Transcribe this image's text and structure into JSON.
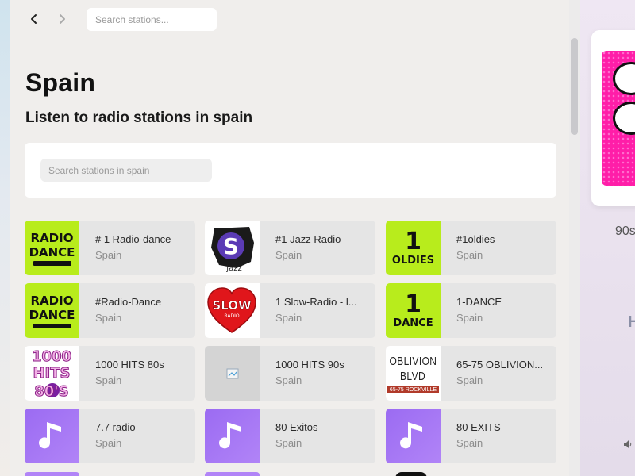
{
  "nav": {
    "back_icon": "chevron-left-icon",
    "forward_icon": "chevron-right-icon",
    "search_placeholder": "Search stations..."
  },
  "page": {
    "title": "Spain",
    "subtitle": "Listen to radio stations in spain",
    "search_placeholder": "Search stations in spain"
  },
  "stations": [
    {
      "name": "# 1 Radio-dance",
      "country": "Spain",
      "thumb": "radio-dance-logo",
      "logo_lines": [
        "RADIO",
        "DANCE"
      ]
    },
    {
      "name": "#1 Jazz Radio",
      "country": "Spain",
      "thumb": "jazz-logo",
      "logo_lines": [
        "jazz"
      ]
    },
    {
      "name": "#1oldies",
      "country": "Spain",
      "thumb": "oldies-logo",
      "logo_lines": [
        "1",
        "OLDIES"
      ]
    },
    {
      "name": "#Radio-Dance",
      "country": "Spain",
      "thumb": "radio-dance-logo",
      "logo_lines": [
        "RADIO",
        "DANCE"
      ]
    },
    {
      "name": "1 Slow-Radio - l...",
      "country": "Spain",
      "thumb": "slow-radio-logo",
      "logo_lines": [
        "SLOW",
        "RADIO"
      ]
    },
    {
      "name": "1-DANCE",
      "country": "Spain",
      "thumb": "dance-logo",
      "logo_lines": [
        "1",
        "DANCE"
      ]
    },
    {
      "name": "1000 HITS 80s",
      "country": "Spain",
      "thumb": "hits-80s-logo",
      "logo_lines": [
        "1000",
        "HITS",
        "80'S"
      ]
    },
    {
      "name": "1000 HITS 90s",
      "country": "Spain",
      "thumb": "broken-image-icon",
      "logo_lines": []
    },
    {
      "name": "65-75 OBLIVION...",
      "country": "Spain",
      "thumb": "oblivion-logo",
      "logo_lines": [
        "OBLIVION",
        "BLVD",
        "65-75 ROCKVILLE"
      ]
    },
    {
      "name": "7.7 radio",
      "country": "Spain",
      "thumb": "music-note-icon",
      "logo_lines": []
    },
    {
      "name": "80 Exitos",
      "country": "Spain",
      "thumb": "music-note-icon",
      "logo_lines": []
    },
    {
      "name": "80 EXITS",
      "country": "Spain",
      "thumb": "music-note-icon",
      "logo_lines": []
    }
  ],
  "now_playing": {
    "title": "90s",
    "letter": "H",
    "volume_icon": "volume-icon"
  },
  "colors": {
    "accent_lime": "#b8ec1c",
    "accent_purple": "#9b6bf2",
    "accent_pink": "#ff1ea8",
    "slow_red": "#e0161b"
  }
}
